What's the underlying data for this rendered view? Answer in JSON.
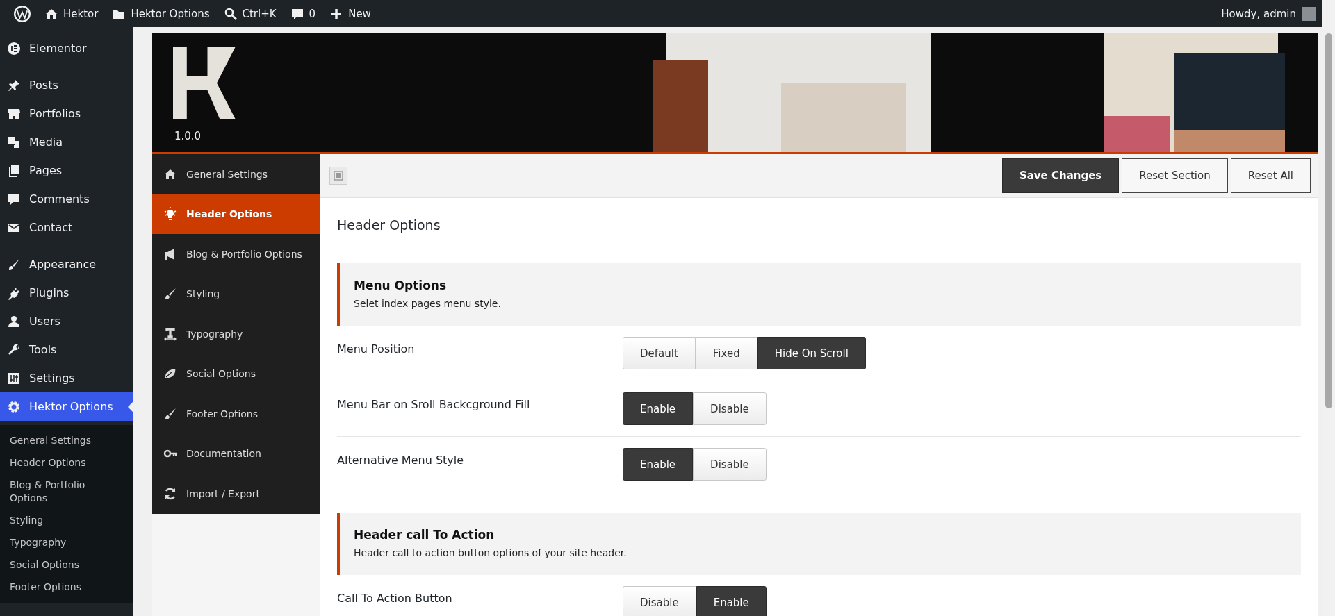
{
  "admin_bar": {
    "items": [
      {
        "kind": "logo"
      },
      {
        "kind": "home",
        "label": "Hektor"
      },
      {
        "kind": "folder",
        "label": "Hektor Options"
      },
      {
        "kind": "search",
        "label": "Ctrl+K"
      },
      {
        "kind": "comment",
        "label": "0"
      },
      {
        "kind": "plus",
        "label": "New"
      }
    ],
    "greeting": "Howdy, admin"
  },
  "sidebar": {
    "groups": [
      {
        "items": [
          {
            "kind": "elementor",
            "label": "Elementor",
            "selected": false
          }
        ]
      },
      {
        "items": [
          {
            "kind": "pin",
            "label": "Posts",
            "selected": false
          },
          {
            "kind": "store",
            "label": "Portfolios",
            "selected": false
          },
          {
            "kind": "media",
            "label": "Media",
            "selected": false
          },
          {
            "kind": "pages",
            "label": "Pages",
            "selected": false
          },
          {
            "kind": "comment",
            "label": "Comments",
            "selected": false
          },
          {
            "kind": "mail",
            "label": "Contact",
            "selected": false
          }
        ]
      },
      {
        "items": [
          {
            "kind": "brush",
            "label": "Appearance",
            "selected": false
          },
          {
            "kind": "plug",
            "label": "Plugins",
            "selected": false
          },
          {
            "kind": "user",
            "label": "Users",
            "selected": false
          },
          {
            "kind": "wrench",
            "label": "Tools",
            "selected": false
          },
          {
            "kind": "sliders",
            "label": "Settings",
            "selected": false
          },
          {
            "kind": "gear",
            "label": "Hektor Options",
            "selected": true
          }
        ]
      }
    ],
    "submenu": [
      "General Settings",
      "Header Options",
      "Blog & Portfolio Options",
      "Styling",
      "Typography",
      "Social Options",
      "Footer Options"
    ]
  },
  "panel": {
    "version": "1.0.0",
    "nav": [
      {
        "kind": "home",
        "label": "General Settings",
        "selected": false
      },
      {
        "kind": "bulb",
        "label": "Header Options",
        "selected": true
      },
      {
        "kind": "megaphone",
        "label": "Blog & Portfolio Options",
        "selected": false
      },
      {
        "kind": "brush",
        "label": "Styling",
        "selected": false
      },
      {
        "kind": "type",
        "label": "Typography",
        "selected": false
      },
      {
        "kind": "leaf",
        "label": "Social Options",
        "selected": false
      },
      {
        "kind": "brush",
        "label": "Footer Options",
        "selected": false
      },
      {
        "kind": "key",
        "label": "Documentation",
        "selected": false
      },
      {
        "kind": "sync",
        "label": "Import / Export",
        "selected": false
      }
    ],
    "buttons": [
      {
        "label": "Save Changes",
        "kind": "primary"
      },
      {
        "label": "Reset Section",
        "kind": "secondary"
      },
      {
        "label": "Reset All",
        "kind": "secondary"
      }
    ],
    "page_title": "Header Options",
    "sections": [
      {
        "title": "Menu Options",
        "description": "Selet index pages menu style.",
        "fields": [
          {
            "label": "Menu Position",
            "options": [
              {
                "label": "Default",
                "selected": false
              },
              {
                "label": "Fixed",
                "selected": false
              },
              {
                "label": "Hide On Scroll",
                "selected": true
              }
            ]
          },
          {
            "label": "Menu Bar on Sroll Backcground Fill",
            "options": [
              {
                "label": "Enable",
                "selected": true
              },
              {
                "label": "Disable",
                "selected": false
              }
            ]
          },
          {
            "label": "Alternative Menu Style",
            "options": [
              {
                "label": "Enable",
                "selected": true
              },
              {
                "label": "Disable",
                "selected": false
              }
            ]
          }
        ]
      },
      {
        "title": "Header call To Action",
        "description": "Header call to action button options of your site header.",
        "fields": [
          {
            "label": "Call To Action Button",
            "options": [
              {
                "label": "Disable",
                "selected": false
              },
              {
                "label": "Enable",
                "selected": true
              }
            ]
          }
        ]
      }
    ]
  }
}
